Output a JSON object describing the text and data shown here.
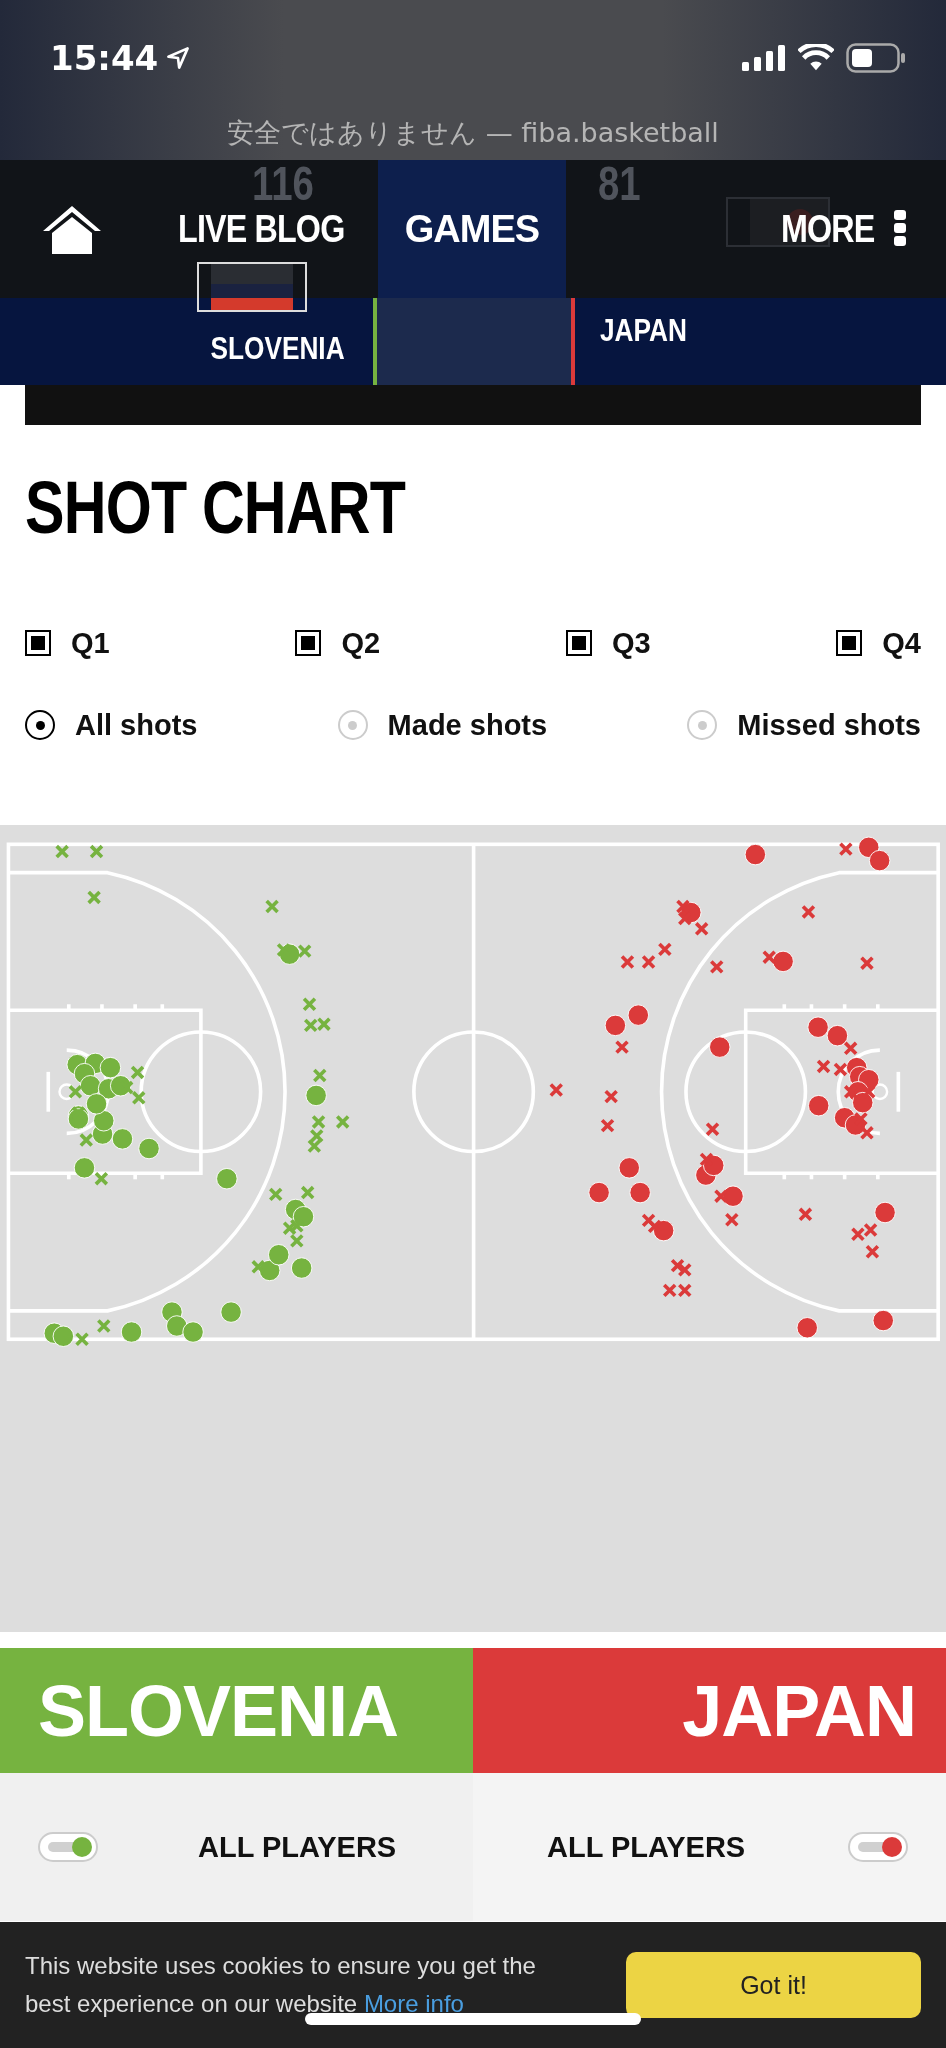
{
  "status_bar": {
    "time": "15:44",
    "url": "安全ではありません — fiba.basketball"
  },
  "nav": {
    "items": [
      {
        "label": "LIVE BLOG",
        "selected": false
      },
      {
        "label": "GAMES",
        "selected": true
      },
      {
        "label": "MORE",
        "selected": false
      }
    ]
  },
  "scoreboard": {
    "home": {
      "name": "SLOVENIA",
      "score": "116",
      "color": "#76b340"
    },
    "away": {
      "name": "JAPAN",
      "score": "81",
      "color": "#db3a3a"
    }
  },
  "title": "SHOT CHART",
  "quarters": [
    {
      "label": "Q1",
      "checked": true
    },
    {
      "label": "Q2",
      "checked": true
    },
    {
      "label": "Q3",
      "checked": true
    },
    {
      "label": "Q4",
      "checked": true
    }
  ],
  "shot_filters": [
    {
      "label": "All shots",
      "selected": true
    },
    {
      "label": "Made shots",
      "selected": false
    },
    {
      "label": "Missed shots",
      "selected": false
    }
  ],
  "teams": [
    {
      "name": "SLOVENIA",
      "color": "#76b340",
      "players_label": "ALL PLAYERS",
      "on": true
    },
    {
      "name": "JAPAN",
      "color": "#db3a3a",
      "players_label": "ALL PLAYERS",
      "on": true
    }
  ],
  "cookie_banner": {
    "text": "This website uses cookies to ensure you get the best experience on our website",
    "link": "More info",
    "button": "Got it!"
  }
}
